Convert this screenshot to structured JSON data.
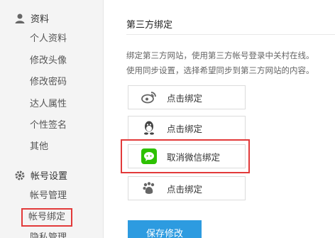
{
  "sidebar": {
    "section1": {
      "label": "资料",
      "icon": "user-icon"
    },
    "section1_items": [
      "个人资料",
      "修改头像",
      "修改密码",
      "达人属性",
      "个性签名",
      "其他"
    ],
    "section2": {
      "label": "帐号设置",
      "icon": "gear-icon"
    },
    "section2_items": [
      "帐号管理",
      "帐号绑定",
      "隐私管理"
    ]
  },
  "main": {
    "title": "第三方绑定",
    "desc_line1": "绑定第三方网站，使用第三方帐号登录中关村在线。",
    "desc_line2": "使用同步设置，选择希望同步到第三方网站的内容。",
    "bindings": [
      {
        "icon": "weibo-icon",
        "label": "点击绑定"
      },
      {
        "icon": "qq-icon",
        "label": "点击绑定"
      },
      {
        "icon": "wechat-icon",
        "label": "取消微信绑定"
      },
      {
        "icon": "baidu-icon",
        "label": "点击绑定"
      }
    ],
    "save_label": "保存修改"
  },
  "colors": {
    "highlight": "#e23a3a",
    "primary": "#2d9be0",
    "wechat": "#2dc100"
  }
}
